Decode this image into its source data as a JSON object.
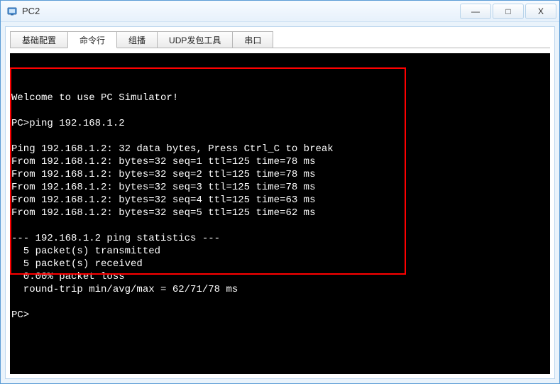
{
  "window": {
    "title": "PC2"
  },
  "tabs": {
    "items": [
      {
        "label": "基础配置",
        "active": false
      },
      {
        "label": "命令行",
        "active": true
      },
      {
        "label": "组播",
        "active": false
      },
      {
        "label": "UDP发包工具",
        "active": false
      },
      {
        "label": "串口",
        "active": false
      }
    ]
  },
  "terminal": {
    "welcome": "Welcome to use PC Simulator!",
    "blank1": "",
    "prompt1": "PC>ping 192.168.1.2",
    "blank2": "",
    "ping_header": "Ping 192.168.1.2: 32 data bytes, Press Ctrl_C to break",
    "replies": [
      "From 192.168.1.2: bytes=32 seq=1 ttl=125 time=78 ms",
      "From 192.168.1.2: bytes=32 seq=2 ttl=125 time=78 ms",
      "From 192.168.1.2: bytes=32 seq=3 ttl=125 time=78 ms",
      "From 192.168.1.2: bytes=32 seq=4 ttl=125 time=63 ms",
      "From 192.168.1.2: bytes=32 seq=5 ttl=125 time=62 ms"
    ],
    "blank3": "",
    "stats_header": "--- 192.168.1.2 ping statistics ---",
    "stats_tx": "  5 packet(s) transmitted",
    "stats_rx": "  5 packet(s) received",
    "stats_loss": "  0.00% packet loss",
    "stats_rtt": "  round-trip min/avg/max = 62/71/78 ms",
    "blank4": "",
    "prompt2": "PC>"
  },
  "win_buttons": {
    "minimize": "—",
    "maximize": "□",
    "close": "X"
  }
}
